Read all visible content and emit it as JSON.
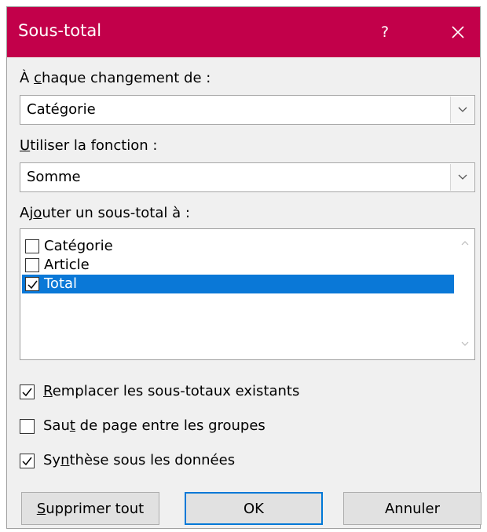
{
  "dialog": {
    "title": "Sous-total",
    "help_label": "?",
    "titlebar_color": "#c2004a",
    "close_icon": "close-icon"
  },
  "group_by": {
    "label_pre": "À ",
    "label_mnemonic": "c",
    "label_post": "haque changement de :",
    "value": "Catégorie"
  },
  "function": {
    "label_mnemonic": "U",
    "label_post": "tiliser la fonction :",
    "value": "Somme"
  },
  "add_subtotal": {
    "label_pre": "Aj",
    "label_mnemonic": "o",
    "label_post": "uter un sous-total à :",
    "items": [
      {
        "label": "Catégorie",
        "checked": false,
        "selected": false
      },
      {
        "label": "Article",
        "checked": false,
        "selected": false
      },
      {
        "label": "Total",
        "checked": true,
        "selected": true
      }
    ],
    "selection_color": "#0a78d7"
  },
  "options": {
    "replace": {
      "pre": "",
      "mnemonic": "R",
      "post": "emplacer les sous-totaux existants",
      "checked": true
    },
    "page_break": {
      "pre": "Sau",
      "mnemonic": "t",
      "post": " de page entre les groupes",
      "checked": false
    },
    "summary": {
      "pre": "Sy",
      "mnemonic": "n",
      "post": "thèse sous les données",
      "checked": true
    }
  },
  "buttons": {
    "remove_all": {
      "mnemonic": "S",
      "post": "upprimer tout"
    },
    "ok": "OK",
    "cancel": "Annuler"
  }
}
